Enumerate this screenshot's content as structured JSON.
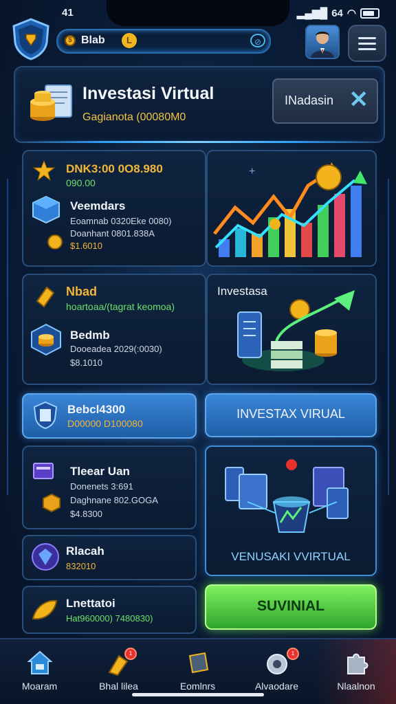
{
  "status_bar": {
    "time": "41",
    "signal": "64"
  },
  "top_bar": {
    "balance": "Blab",
    "chip": "L"
  },
  "header": {
    "title": "Investasi Virtual",
    "subtitle": "Gagianota (00080M0",
    "close_label": "INadasin"
  },
  "card1": {
    "headline": "DNK3:00 0O8.980",
    "headline_sub": "090.00",
    "item_title": "Veemdars",
    "line1": "Eoamnab 0320Eke 0080)",
    "line2": "Doanhant 0801.838A",
    "amount": "$1.6010"
  },
  "card2": {
    "headline": "Nbad",
    "headline_sub": "hoartoaa/(tagrat keomoa)",
    "item_title": "Bedmb",
    "line1": "Dooeadea 2029(:0030)",
    "amount": "$8.1010",
    "panel_label": "Investasa"
  },
  "card3": {
    "title": "Bebcl4300",
    "sub": "D00000 D100080"
  },
  "buttons": {
    "invest_virtual": "INVESTAX VIRUAL",
    "vr_label": "VENUSAKI VVIRTUAL",
    "primary": "SUVINIAL"
  },
  "card4": {
    "title": "Tleear Uan",
    "line1": "Donenets 3:691",
    "line2": "Daghnane 802.GOGA",
    "amount": "$4.8300"
  },
  "card5": {
    "title": "Rlacah",
    "amount": "832010"
  },
  "card6": {
    "title": "Lnettatoi",
    "sub": "Hat960000) 7480830)"
  },
  "nav": [
    {
      "label": "Moaram"
    },
    {
      "label": "Bhal lilea",
      "badge": "1"
    },
    {
      "label": "Eomlnrs"
    },
    {
      "label": "Alvaodare",
      "badge": "1"
    },
    {
      "label": "Nlaalnon"
    }
  ],
  "colors": {
    "accent": "#2fa3ff",
    "gold": "#f2b638",
    "green": "#6ee06a",
    "cta_green": "#4ed23c",
    "bg": "#0a1d38"
  }
}
